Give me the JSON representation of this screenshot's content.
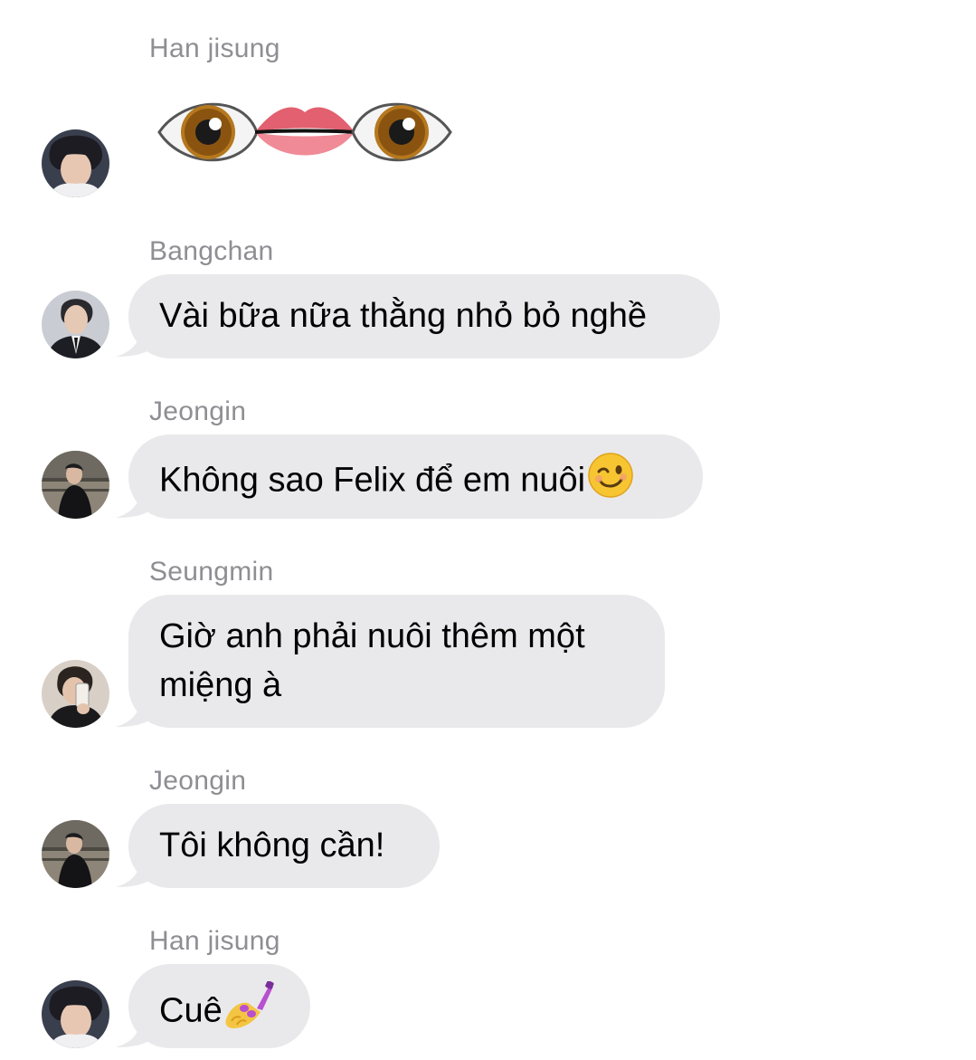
{
  "messages": [
    {
      "sender": "Han jisung",
      "type": "emoji",
      "emoji_names": [
        "eye-emoji",
        "lips-emoji",
        "eye-emoji"
      ],
      "text": ""
    },
    {
      "sender": "Bangchan",
      "type": "text",
      "text": "Vài bữa nữa thằng nhỏ bỏ nghề"
    },
    {
      "sender": "Jeongin",
      "type": "text",
      "text": "Không sao Felix để em nuôi",
      "trailing_emoji": "winking-face-emoji"
    },
    {
      "sender": "Seungmin",
      "type": "text",
      "line1": "Giờ anh phải nuôi thêm một",
      "line2": "miệng à"
    },
    {
      "sender": "Jeongin",
      "type": "text",
      "text": "Tôi không cần!"
    },
    {
      "sender": "Han jisung",
      "type": "text",
      "text": "Cuê",
      "trailing_emoji": "nail-polish-emoji"
    }
  ],
  "colors": {
    "bubble": "#e9e9eb",
    "sender_name": "#8e8e93",
    "text": "#000000",
    "background": "#ffffff"
  }
}
